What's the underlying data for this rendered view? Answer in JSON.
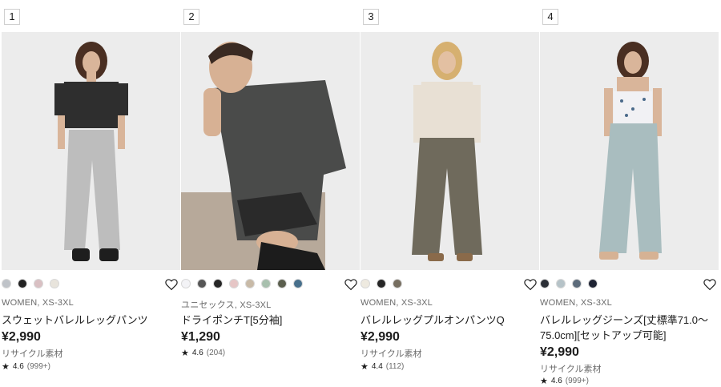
{
  "products": [
    {
      "rank": "1",
      "image": "woman-black-shirt-grey-sweatpants",
      "colors": [
        "#bfc3c8",
        "#222222",
        "#d9c0c3",
        "#e8e4dc"
      ],
      "gender_size": "WOMEN, XS-3XL",
      "name": "スウェットバレルレッグパンツ",
      "price": "¥2,990",
      "note": "リサイクル素材",
      "rating": "4.6",
      "reviews": "(999+)"
    },
    {
      "rank": "2",
      "image": "man-grey-tshirt-beige-pants",
      "colors": [
        "#f3f3f6",
        "#555555",
        "#262626",
        "#e6c6c6",
        "#c8baa7",
        "#a8c0ae",
        "#5b5f4e",
        "#48708c"
      ],
      "gender_size": "ユニセックス, XS-3XL",
      "name": "ドライポンチT[5分袖]",
      "price": "¥1,290",
      "note": "",
      "rating": "4.6",
      "reviews": "(204)"
    },
    {
      "rank": "3",
      "image": "woman-beige-top-olive-pants",
      "colors": [
        "#eeeae0",
        "#262626",
        "#766e60"
      ],
      "gender_size": "WOMEN, XS-3XL",
      "name": "バレルレッグプルオンパンツQ",
      "price": "¥2,990",
      "note": "リサイクル素材",
      "rating": "4.4",
      "reviews": "(112)"
    },
    {
      "rank": "4",
      "image": "woman-floral-top-light-jeans",
      "colors": [
        "#2b2f36",
        "#b6c3c8",
        "#5c6b7a",
        "#1e2333"
      ],
      "gender_size": "WOMEN, XS-3XL",
      "name": "バレルレッグジーンズ[丈標準71.0～75.0cm][セットアップ可能]",
      "price": "¥2,990",
      "note": "リサイクル素材",
      "rating": "4.6",
      "reviews": "(999+)"
    }
  ],
  "icons": {
    "favorite": "heart-outline-icon",
    "rating": "star-icon"
  }
}
